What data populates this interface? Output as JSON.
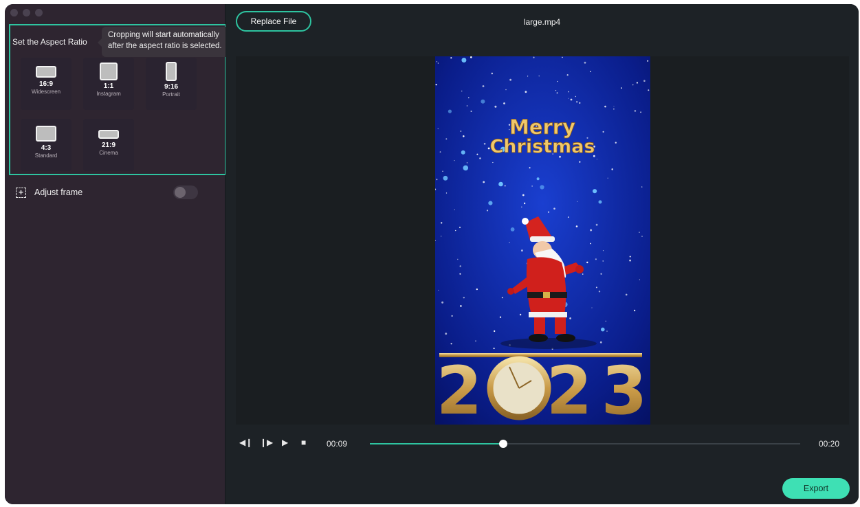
{
  "window": {
    "controls": [
      "close",
      "minimize",
      "zoom"
    ]
  },
  "sidebar": {
    "section_title": "Set the Aspect Ratio",
    "tooltip": {
      "line1": "Cropping will start automatically",
      "line2": "after the aspect ratio is selected."
    },
    "ratios": [
      {
        "ratio": "16:9",
        "name": "Widescreen",
        "icon": "widescreen-shape-icon"
      },
      {
        "ratio": "1:1",
        "name": "Instagram",
        "icon": "square-shape-icon"
      },
      {
        "ratio": "9:16",
        "name": "Portrait",
        "icon": "portrait-shape-icon"
      },
      {
        "ratio": "4:3",
        "name": "Standard",
        "icon": "standard-shape-icon"
      },
      {
        "ratio": "21:9",
        "name": "Cinema",
        "icon": "cinema-shape-icon"
      }
    ],
    "adjust_frame": {
      "label": "Adjust frame",
      "icon": "frame-add-icon",
      "enabled": false
    }
  },
  "main": {
    "replace_button": "Replace File",
    "file_name": "large.mp4",
    "preview": {
      "title_line1": "Merry",
      "title_line2": "Christmas",
      "year_digit1": "2",
      "year_digit3": "2",
      "year_digit4": "3"
    },
    "player": {
      "buttons": [
        "step-back-icon",
        "step-forward-icon",
        "play-icon",
        "stop-icon"
      ],
      "current_time": "00:09",
      "total_time": "00:20",
      "progress": 0.31
    },
    "export_button": "Export"
  },
  "colors": {
    "accent": "#2ec4a0",
    "export": "#3ee0b4",
    "sidebar": "#2e2530",
    "main": "#1d2226"
  }
}
